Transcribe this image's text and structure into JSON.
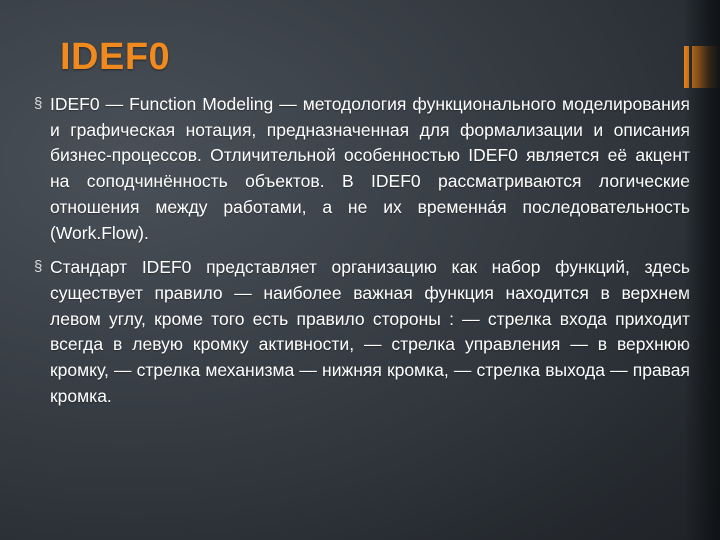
{
  "slide": {
    "title": "IDEF0",
    "theme": {
      "accent_color": "#e8811a",
      "title_color": "#f08a1e",
      "text_color": "#ffffff",
      "background_color": "#3b4148"
    },
    "bullets": [
      {
        "marker": "§",
        "text": "IDEF0 — Function Modeling — методология функционального моделирования и графическая нотация, предназначенная для формализации и описания бизнес-процессов. Отличительной особенностью IDEF0 является её акцент на соподчинённость объектов. В IDEF0 рассматриваются логические отношения между работами, а не их временна́я последовательность (Work.Flow)."
      },
      {
        "marker": "§",
        "text": "Стандарт IDEF0 представляет организацию как набор функций, здесь существует правило — наиболее важная функция находится в верхнем левом углу, кроме того есть правило стороны : — стрелка входа приходит всегда в левую кромку активности, — стрелка управления — в верхнюю кромку, — стрелка механизма — нижняя кромка, — стрелка выхода — правая кромка."
      }
    ]
  }
}
